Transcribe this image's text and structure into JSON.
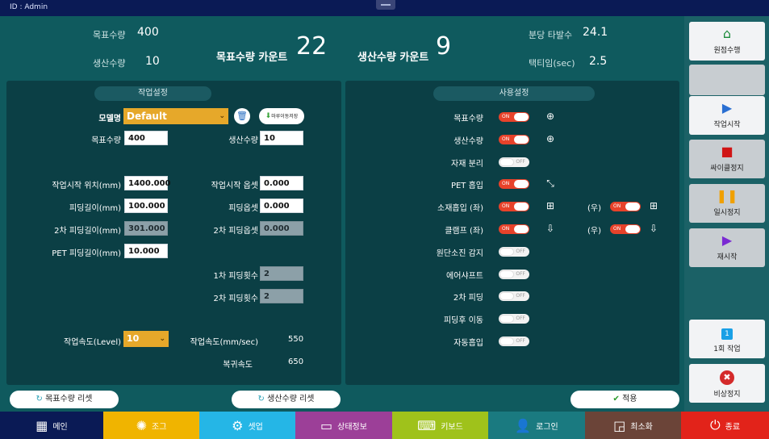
{
  "header": {
    "id_text": "ID : Admin"
  },
  "stats": {
    "target_qty_label": "목표수량",
    "target_qty_value": "400",
    "prod_qty_label": "생산수량",
    "prod_qty_value": "10",
    "target_count_label": "목표수량 카운트",
    "target_count_value": "22",
    "prod_count_label": "생산수량 카운트",
    "prod_count_value": "9",
    "per_min_label": "분당 타발수",
    "per_min_value": "24.1",
    "tact_label": "택티임(sec)",
    "tact_value": "2.5"
  },
  "work": {
    "title": "작업설정",
    "model_label": "모델명",
    "model_value": "Default",
    "mold_btn": "마루이동저장",
    "target_label": "목표수량",
    "target_value": "400",
    "prod_label": "생산수량",
    "prod_value": "10",
    "start_pos_label": "작업시작 위치(mm)",
    "start_pos_value": "1400.000",
    "start_off_label": "작업시작 옵셋",
    "start_off_value": "0.000",
    "feed_len_label": "피딩길이(mm)",
    "feed_len_value": "100.000",
    "feed_off_label": "피딩옵셋",
    "feed_off_value": "0.000",
    "feed2_len_label": "2차 피딩길이(mm)",
    "feed2_len_value": "301.000",
    "feed2_off_label": "2차 피딩옵셋",
    "feed2_off_value": "0.000",
    "pet_len_label": "PET 피딩길이(mm)",
    "pet_len_value": "10.000",
    "feed1_cnt_label": "1차 피딩횟수",
    "feed1_cnt_value": "2",
    "feed2_cnt_label": "2차 피딩횟수",
    "feed2_cnt_value": "2",
    "speed_level_label": "작업속도(Level)",
    "speed_level_value": "10",
    "speed_mm_label": "작업속도(mm/sec)",
    "speed_mm_value": "550",
    "return_label": "복귀속도",
    "return_value": "650"
  },
  "usage": {
    "title": "사용설정",
    "rows": [
      {
        "label": "목표수량",
        "state": "ON",
        "icon": "plus-circle-filled-icon"
      },
      {
        "label": "생산수량",
        "state": "ON",
        "icon": "plus-circle-outline-icon"
      },
      {
        "label": "자재 분리",
        "state": "OFF"
      },
      {
        "label": "PET 흡입",
        "state": "ON",
        "icon": "shrink-icon"
      },
      {
        "label": "소재흡입 (좌)",
        "state": "ON",
        "icon": "frame-icon",
        "right_label": "(우)",
        "right_state": "ON"
      },
      {
        "label": "클램프 (좌)",
        "state": "ON",
        "icon": "down-box-icon",
        "right_label": "(우)",
        "right_state": "ON"
      },
      {
        "label": "원단소진 감지",
        "state": "OFF"
      },
      {
        "label": "에어샤프트",
        "state": "OFF"
      },
      {
        "label": "2차 피딩",
        "state": "OFF"
      },
      {
        "label": "피딩후 이동",
        "state": "OFF"
      },
      {
        "label": "자동흡입",
        "state": "OFF"
      }
    ]
  },
  "buttons": {
    "reset_target": "목표수량 리셋",
    "reset_prod": "생산수량 리셋",
    "apply": "적용"
  },
  "side": {
    "origin": "원점수행",
    "start": "작업시작",
    "cycle_stop": "싸이클정지",
    "pause": "일시정지",
    "resume": "재시작",
    "one_time_num": "1",
    "one_time": "1회 작업",
    "emergency": "비상정지"
  },
  "nav": {
    "main": "메인",
    "jog": "조그",
    "setup": "셋업",
    "status": "상태정보",
    "keyboard": "키보드",
    "login": "로그인",
    "minimize": "최소화",
    "exit": "종료"
  },
  "colors": {
    "bg": "#0f5a5e",
    "panel": "#0b3f45",
    "accent_on": "#e7422a",
    "nav_main": "#0a1a55",
    "nav_jog": "#f0b400",
    "nav_setup": "#25b6e6",
    "nav_status": "#9c3f98",
    "nav_keyboard": "#9fc21b",
    "nav_login": "#1a7a80",
    "nav_minimize": "#6b4438",
    "nav_exit": "#e2231a"
  }
}
